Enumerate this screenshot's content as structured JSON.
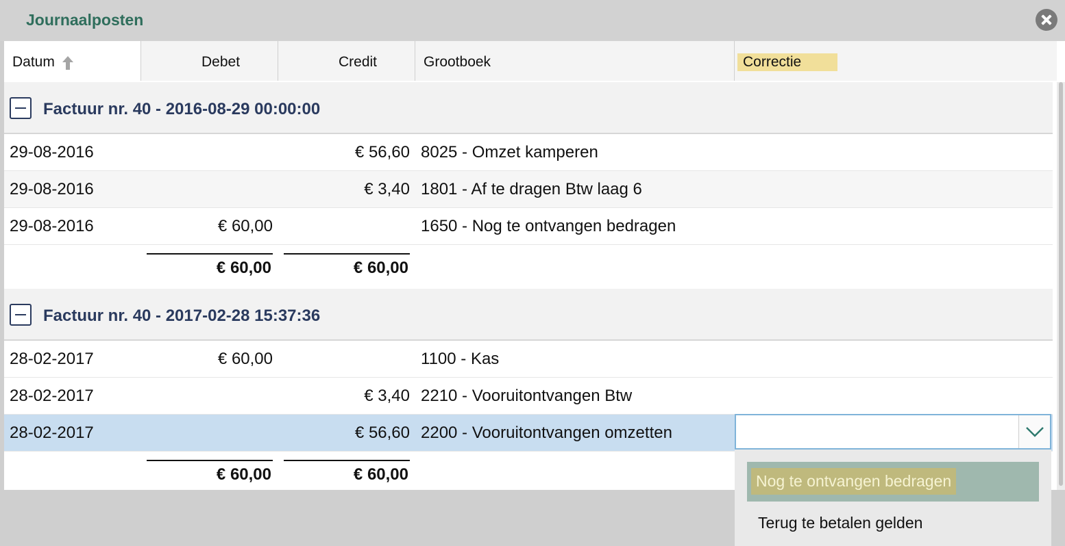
{
  "window": {
    "title": "Journaalposten",
    "close_icon": "close-icon"
  },
  "columns": {
    "datum": "Datum",
    "debet": "Debet",
    "credit": "Credit",
    "grootboek": "Grootboek",
    "correctie": "Correctie"
  },
  "groups": [
    {
      "title": "Factuur nr. 40 - 2016-08-29 00:00:00",
      "rows": [
        {
          "date": "29-08-2016",
          "debet": "",
          "credit": "€ 56,60",
          "grootboek": "8025 - Omzet kamperen"
        },
        {
          "date": "29-08-2016",
          "debet": "",
          "credit": "€ 3,40",
          "grootboek": "1801 - Af te dragen Btw laag 6"
        },
        {
          "date": "29-08-2016",
          "debet": "€ 60,00",
          "credit": "",
          "grootboek": "1650 - Nog te ontvangen bedragen"
        }
      ],
      "totals": {
        "debet": "€ 60,00",
        "credit": "€ 60,00"
      }
    },
    {
      "title": "Factuur nr. 40 - 2017-02-28 15:37:36",
      "rows": [
        {
          "date": "28-02-2017",
          "debet": "€ 60,00",
          "credit": "",
          "grootboek": "1100 - Kas"
        },
        {
          "date": "28-02-2017",
          "debet": "",
          "credit": "€ 3,40",
          "grootboek": "2210 - Vooruitontvangen Btw"
        },
        {
          "date": "28-02-2017",
          "debet": "",
          "credit": "€ 56,60",
          "grootboek": "2200 - Vooruitontvangen omzetten"
        }
      ],
      "totals": {
        "debet": "€ 60,00",
        "credit": "€ 60,00"
      }
    }
  ],
  "correctie_select": {
    "value": "",
    "options": [
      "Nog te ontvangen bedragen",
      "Terug te betalen gelden"
    ],
    "highlighted_option": "Nog te ontvangen bedragen"
  },
  "colors": {
    "title": "#2f6e5c",
    "group_title": "#2a3a5e",
    "selected_row": "#c8ddf0",
    "correctie_highlight": "#f1df9a",
    "dropdown_active": "#9fb8ae"
  }
}
